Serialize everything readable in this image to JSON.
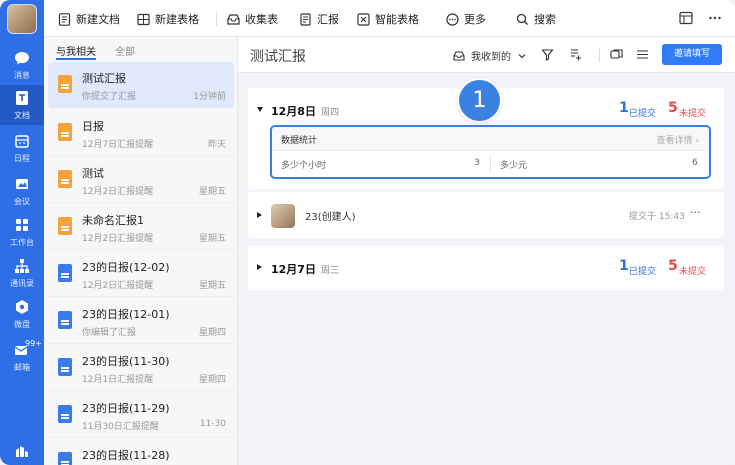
{
  "toolbar": {
    "new_doc": "新建文档",
    "new_sheet": "新建表格",
    "collect_form": "收集表",
    "report": "汇报",
    "smart_sheet": "智能表格",
    "more": "更多",
    "search": "搜索"
  },
  "rail": {
    "items": [
      {
        "label": "消息",
        "icon": "chat-bubble-icon"
      },
      {
        "label": "文档",
        "icon": "document-icon"
      },
      {
        "label": "日程",
        "icon": "calendar-icon"
      },
      {
        "label": "会议",
        "icon": "video-icon"
      },
      {
        "label": "工作台",
        "icon": "grid-icon"
      },
      {
        "label": "通讯录",
        "icon": "org-chart-icon"
      },
      {
        "label": "微盘",
        "icon": "drive-icon"
      },
      {
        "label": "邮箱",
        "icon": "mail-icon"
      }
    ],
    "mail_badge": "99+"
  },
  "list": {
    "tabs": [
      "与我相关",
      "全部"
    ],
    "items": [
      {
        "title": "测试汇报",
        "sub": "你提交了汇报",
        "time": "1分钟前",
        "color": "orange"
      },
      {
        "title": "日报",
        "sub": "12月7日汇报提醒",
        "time": "昨天",
        "color": "orange"
      },
      {
        "title": "测试",
        "sub": "12月2日汇报提醒",
        "time": "星期五",
        "color": "orange"
      },
      {
        "title": "未命名汇报1",
        "sub": "12月2日汇报提醒",
        "time": "星期五",
        "color": "orange"
      },
      {
        "title": "23的日报(12-02)",
        "sub": "12月2日汇报提醒",
        "time": "星期五",
        "color": "blue"
      },
      {
        "title": "23的日报(12-01)",
        "sub": "你编辑了汇报",
        "time": "星期四",
        "color": "blue"
      },
      {
        "title": "23的日报(11-30)",
        "sub": "12月1日汇报提醒",
        "time": "星期四",
        "color": "blue"
      },
      {
        "title": "23的日报(11-29)",
        "sub": "11月30日汇报提醒",
        "time": "11-30",
        "color": "blue"
      },
      {
        "title": "23的日报(11-28)",
        "sub": "",
        "time": "",
        "color": "blue"
      }
    ]
  },
  "main": {
    "title": "测试汇报",
    "filter": "我收到的",
    "invite_button": "邀请填写",
    "step_number": "1",
    "day1": {
      "date": "12月8日",
      "weekday": "周四",
      "submitted_count": "1",
      "submitted_label": "已提交",
      "unsubmitted_count": "5",
      "unsubmitted_label": "未提交",
      "stats_title": "数据统计",
      "detail_link": "查看详情 ›",
      "metric1_label": "多少个小时",
      "metric1_value": "3",
      "metric2_label": "多少元",
      "metric2_value": "6"
    },
    "person": {
      "name": "23(创建人)",
      "submitted_time": "提交于 15:43",
      "more": "···"
    },
    "day2": {
      "date": "12月7日",
      "weekday": "周三",
      "submitted_count": "1",
      "submitted_label": "已提交",
      "unsubmitted_count": "5",
      "unsubmitted_label": "未提交"
    }
  }
}
